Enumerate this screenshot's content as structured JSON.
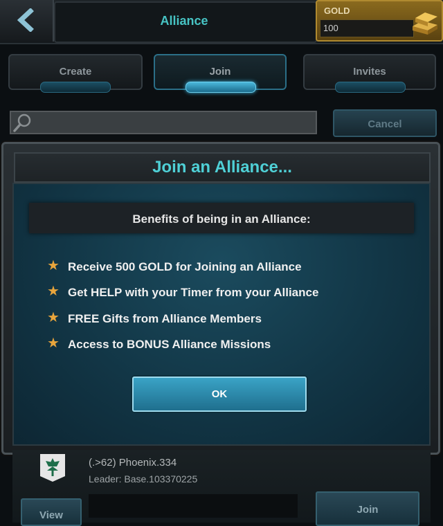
{
  "header": {
    "title": "Alliance",
    "gold_label": "GOLD",
    "gold_value": "100"
  },
  "tabs": [
    {
      "label": "Create"
    },
    {
      "label": "Join"
    },
    {
      "label": "Invites"
    }
  ],
  "search": {
    "placeholder": "",
    "cancel_label": "Cancel"
  },
  "modal": {
    "title": "Join an Alliance...",
    "benefits_heading": "Benefits of being in an Alliance:",
    "benefits": [
      "Receive 500 GOLD for Joining an Alliance",
      "Get HELP with your Timer from your Alliance",
      "FREE Gifts from Alliance Members",
      "Access to BONUS Alliance Missions"
    ],
    "ok_label": "OK"
  },
  "list_row": {
    "name": "(.>62) Phoenix.334",
    "leader": "Leader: Base.103370225",
    "view_label": "View",
    "join_label": "Join"
  },
  "colors": {
    "accent": "#47c4c4",
    "star": "#e8a53c",
    "gold_frame": "#b08a30"
  }
}
